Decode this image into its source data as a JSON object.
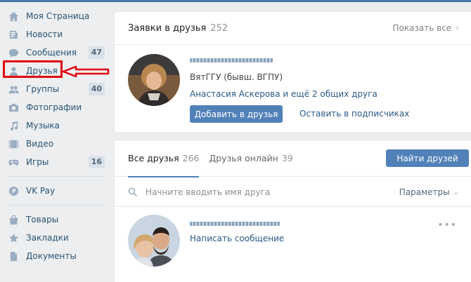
{
  "sidebar": {
    "items": [
      {
        "label": "Моя Страница",
        "icon": "home-icon",
        "count": ""
      },
      {
        "label": "Новости",
        "icon": "news-icon",
        "count": ""
      },
      {
        "label": "Сообщения",
        "icon": "message-icon",
        "count": "47"
      },
      {
        "label": "Друзья",
        "icon": "person-icon",
        "count": ""
      },
      {
        "label": "Группы",
        "icon": "group-icon",
        "count": "40"
      },
      {
        "label": "Фотографии",
        "icon": "camera-icon",
        "count": ""
      },
      {
        "label": "Музыка",
        "icon": "music-icon",
        "count": ""
      },
      {
        "label": "Видео",
        "icon": "video-icon",
        "count": ""
      },
      {
        "label": "Игры",
        "icon": "gamepad-icon",
        "count": "16"
      }
    ],
    "pay": {
      "label": "VK Pay",
      "icon": "vkpay-icon"
    },
    "extra": [
      {
        "label": "Товары",
        "icon": "bag-icon"
      },
      {
        "label": "Закладки",
        "icon": "star-icon"
      },
      {
        "label": "Документы",
        "icon": "document-icon"
      }
    ]
  },
  "requests": {
    "title": "Заявки в друзья",
    "count": "252",
    "show_all": "Показать все",
    "person": {
      "school": "ВятГГУ (бывш. ВГПУ)",
      "mutual": "Анастасия Аскерова и ещё 2 общих друга",
      "add_label": "Добавить в друзья",
      "subscribe_label": "Оставить в подписчиках"
    }
  },
  "friends": {
    "tabs": [
      {
        "label": "Все друзья",
        "count": "266"
      },
      {
        "label": "Друзья онлайн",
        "count": "39"
      }
    ],
    "find_label": "Найти друзей",
    "search_placeholder": "Начните вводить имя друга",
    "params_label": "Параметры",
    "first_friend": {
      "write_label": "Написать сообщение"
    }
  },
  "colors": {
    "accent": "#5181b8",
    "link": "#2a5885",
    "annotation": "#e0000f"
  }
}
